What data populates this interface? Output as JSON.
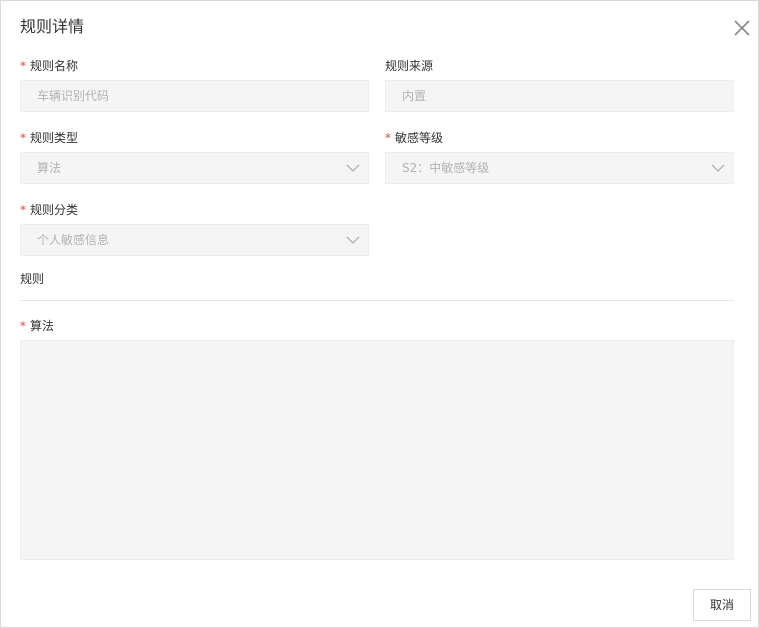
{
  "dialog": {
    "title": "规则详情"
  },
  "required_mark": "*",
  "fields": {
    "rule_name": {
      "label": "规则名称",
      "value": "车辆识别代码"
    },
    "rule_source": {
      "label": "规则来源",
      "value": "内置"
    },
    "rule_type": {
      "label": "规则类型",
      "value": "算法"
    },
    "sensitivity_level": {
      "label": "敏感等级",
      "value": "S2：中敏感等级"
    },
    "rule_category": {
      "label": "规则分类",
      "value": "个人敏感信息"
    }
  },
  "section": {
    "title": "规则"
  },
  "algorithm": {
    "label": "算法",
    "value": ""
  },
  "footer": {
    "cancel_label": "取消"
  },
  "icons": {
    "close": "close-icon",
    "dropdown": "chevron-down-icon"
  },
  "colors": {
    "required": "#e54545",
    "field_bg": "#f5f5f5",
    "placeholder_text": "#b3b3b3"
  }
}
